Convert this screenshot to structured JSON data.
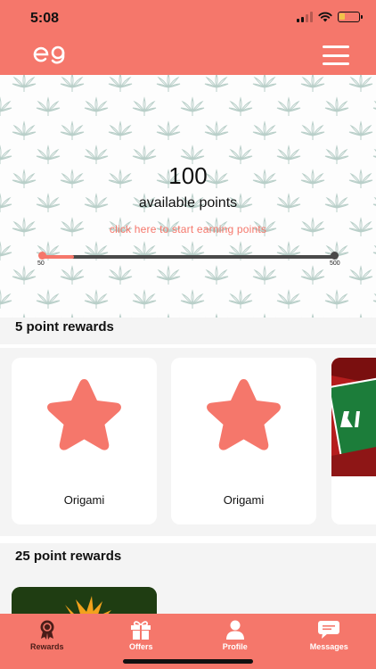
{
  "status": {
    "time": "5:08"
  },
  "header": {
    "logo_text": "e9"
  },
  "points": {
    "value": "100",
    "label": "available points",
    "earn_link": "click here to start earning points",
    "progress": {
      "min": "50",
      "max": "500",
      "current": 100
    }
  },
  "sections": [
    {
      "title": "5 point rewards",
      "cards": [
        {
          "name": "Origami",
          "icon": "star-icon"
        },
        {
          "name": "Origami",
          "icon": "star-icon"
        }
      ]
    },
    {
      "title": "25 point rewards"
    }
  ],
  "tabs": [
    {
      "label": "Rewards",
      "icon": "award-icon",
      "active": true
    },
    {
      "label": "Offers",
      "icon": "gift-icon",
      "active": false
    },
    {
      "label": "Profile",
      "icon": "person-icon",
      "active": false
    },
    {
      "label": "Messages",
      "icon": "chat-icon",
      "active": false
    }
  ],
  "colors": {
    "brand": "#f5776b",
    "active_tab": "#4a1d18",
    "track": "#4a4a4a"
  }
}
